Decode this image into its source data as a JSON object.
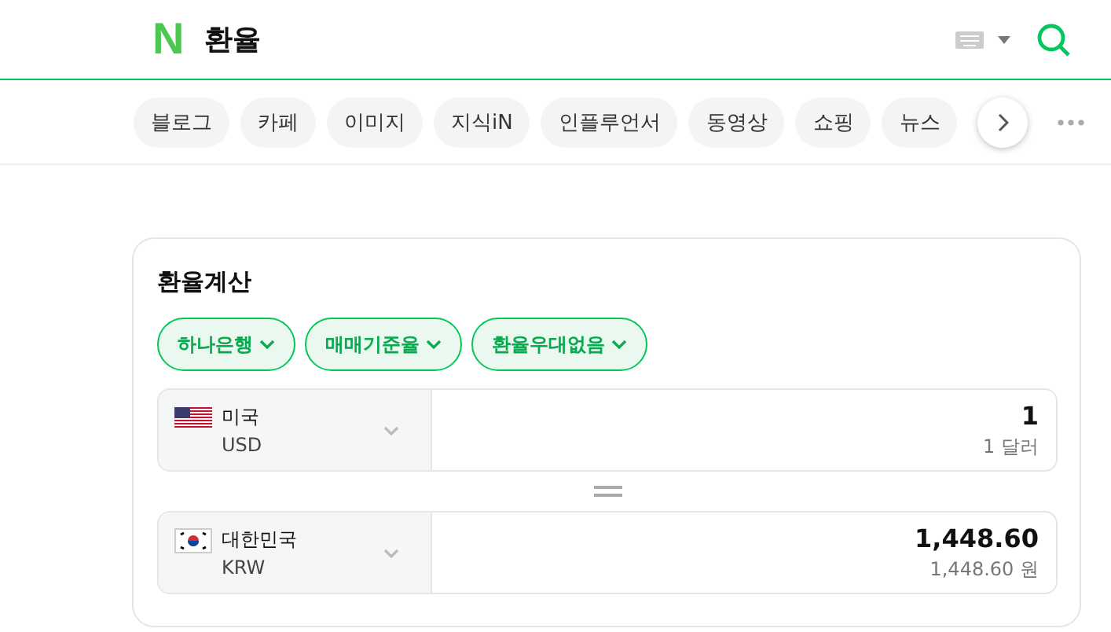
{
  "header": {
    "logo": "N",
    "title": "환율"
  },
  "tabs": [
    {
      "label": "블로그",
      "selected": false
    },
    {
      "label": "카페",
      "selected": false
    },
    {
      "label": "이미지",
      "selected": false
    },
    {
      "label": "지식iN",
      "selected": false
    },
    {
      "label": "인플루언서",
      "selected": false
    },
    {
      "label": "동영상",
      "selected": false
    },
    {
      "label": "쇼핑",
      "selected": false
    },
    {
      "label": "뉴스",
      "selected": false
    }
  ],
  "calculator": {
    "title": "환율계산",
    "filters": [
      "하나은행",
      "매매기준율",
      "환율우대없음"
    ],
    "currencies": [
      {
        "kind": "us",
        "country": "미국",
        "code": "USD",
        "amount": "1",
        "reading": "1 달러"
      },
      {
        "kind": "kr",
        "country": "대한민국",
        "code": "KRW",
        "amount": "1,448.60",
        "reading": "1,448.60 원"
      }
    ]
  }
}
